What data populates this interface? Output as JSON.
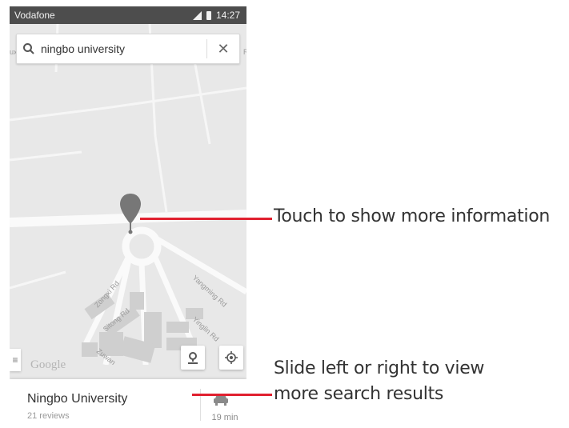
{
  "status_bar": {
    "carrier": "Vodafone",
    "time": "14:27"
  },
  "search": {
    "value": "ningbo university",
    "placeholder": ""
  },
  "map": {
    "edge_label_left": "ux",
    "edge_label_right": "R",
    "street_labels": {
      "zongxi": "Zongxi Rd",
      "sitong": "Sitong Rd",
      "yangming": "Yangming Rd",
      "yinglin": "Yinglin Rd",
      "zuwan": "Zuwan"
    },
    "watermark": "Google"
  },
  "result": {
    "name": "Ningbo University",
    "reviews": "21 reviews",
    "drive_time": "19 min"
  },
  "callouts": {
    "pin": "Touch to show more information",
    "slide_line1": "Slide left or right to view",
    "slide_line2": "more search results"
  },
  "colors": {
    "accent": "#e0202f",
    "status_bar": "#4d4d4d",
    "map_bg": "#e8e8e8",
    "road": "#fafafa",
    "block": "#cfcfcf",
    "pin": "#777777"
  },
  "icons": {
    "search": "search-icon",
    "close": "close-icon",
    "pin": "map-pin-icon",
    "directions": "directions-pin-icon",
    "location": "my-location-icon",
    "car": "car-icon",
    "menu": "menu-icon"
  }
}
